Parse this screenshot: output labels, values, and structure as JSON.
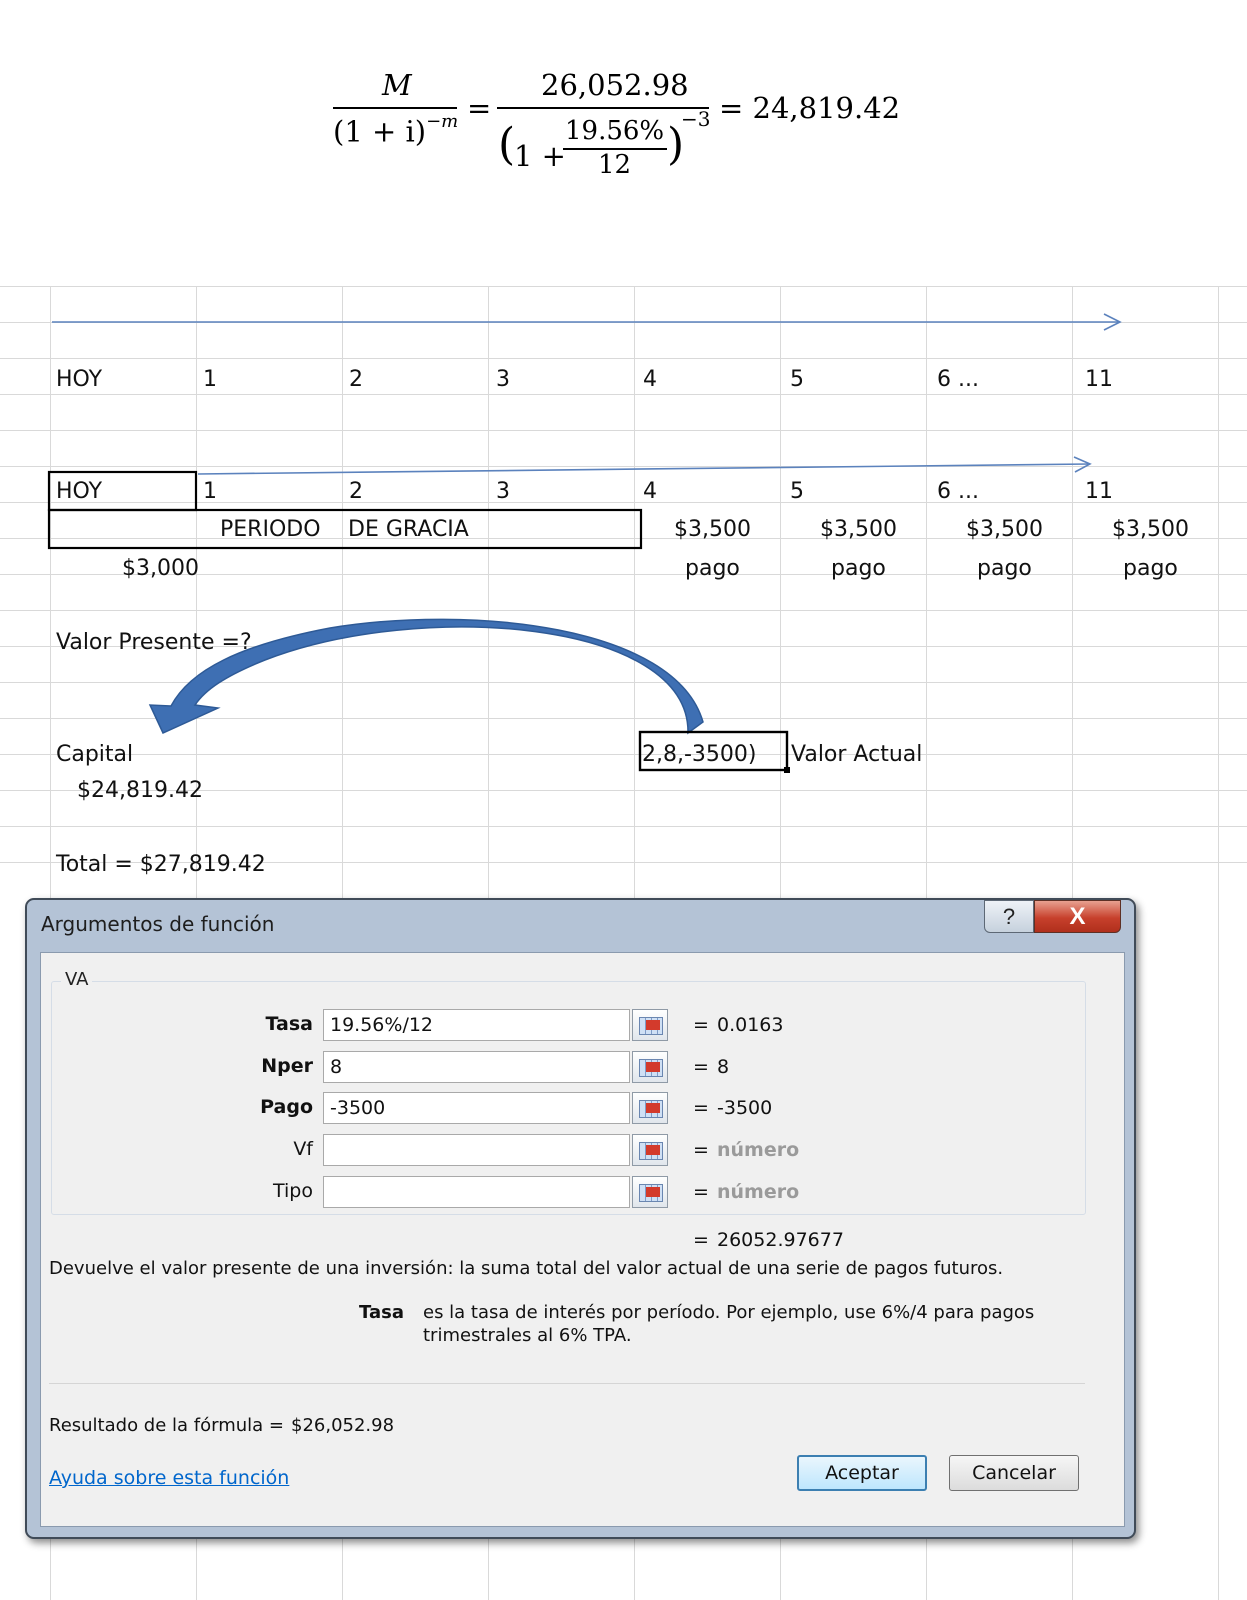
{
  "formula": {
    "numerator_left": "M",
    "denominator_left": "(1 + i)",
    "denominator_left_exp": "−m",
    "equals": "=",
    "numerator_right": "26,052.98",
    "paren_open": "(1 +",
    "rate": "19.56%",
    "months": "12",
    "paren_close": ")",
    "paren_exp": "−3",
    "result": "= 24,819.42"
  },
  "timeline1": {
    "labels": [
      "HOY",
      "1",
      "2",
      "3",
      "4",
      "5",
      "6 ...",
      "11"
    ]
  },
  "timeline2": {
    "labels": [
      "HOY",
      "1",
      "2",
      "3",
      "4",
      "5",
      "6 ...",
      "11"
    ],
    "grace_label": "PERIODO",
    "grace_label2": "DE GRACIA",
    "payments": [
      "$3,500",
      "$3,500",
      "$3,500",
      "$3,500"
    ],
    "pago": [
      "pago",
      "pago",
      "pago",
      "pago"
    ],
    "initial_amount": "$3,000"
  },
  "sheet": {
    "valor_presente": "Valor Presente =?",
    "capital_label": "Capital",
    "capital_value": "$24,819.42",
    "formula_cell": "2,8,-3500)",
    "valor_actual": "Valor Actual",
    "total": "Total = $27,819.42"
  },
  "dialog": {
    "title": "Argumentos de función",
    "help_button": "?",
    "close_button": "X",
    "function_name": "VA",
    "args": [
      {
        "label": "Tasa",
        "value": "19.56%/12",
        "result": "0.0163",
        "bold": true
      },
      {
        "label": "Nper",
        "value": "8",
        "result": "8",
        "bold": true
      },
      {
        "label": "Pago",
        "value": "-3500",
        "result": "-3500",
        "bold": true
      },
      {
        "label": "Vf",
        "value": "",
        "result": "número",
        "bold": false
      },
      {
        "label": "Tipo",
        "value": "",
        "result": "número",
        "bold": false
      }
    ],
    "equals": "=",
    "total_result": "26052.97677",
    "description": "Devuelve el valor presente de una inversión: la suma total del valor actual de una serie de pagos futuros.",
    "arg_help_name": "Tasa",
    "arg_help_text1": "es la tasa de interés por período. Por ejemplo, use 6%/4 para pagos",
    "arg_help_text2": "trimestrales al 6% TPA.",
    "result_label": "Resultado de la fórmula =",
    "result_value": "$26,052.98",
    "help_link": "Ayuda sobre esta función",
    "ok_button": "Aceptar",
    "cancel_button": "Cancelar"
  },
  "colors": {
    "arrow_line": "#5b82bd",
    "curved_arrow": "#3e6fb3",
    "link": "#0066cc",
    "close_button": "#c7402c"
  }
}
